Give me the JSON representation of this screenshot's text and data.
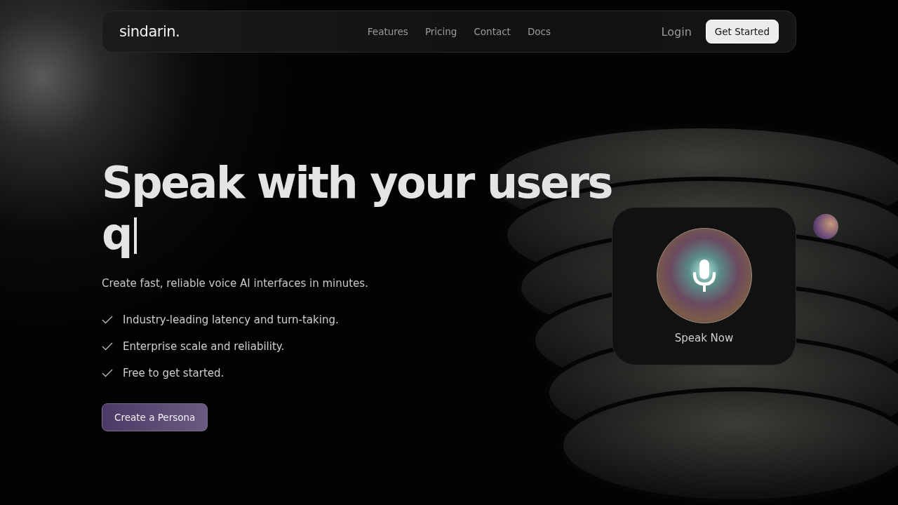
{
  "nav": {
    "logo": "sindarin.",
    "links": [
      "Features",
      "Pricing",
      "Contact",
      "Docs"
    ],
    "login": "Login",
    "cta": "Get Started"
  },
  "hero": {
    "headline": "Speak with your users",
    "typed": "q",
    "subtitle": "Create fast, reliable voice AI interfaces in minutes.",
    "features": [
      "Industry-leading latency and turn-taking.",
      "Enterprise scale and reliability.",
      "Free to get started."
    ],
    "button": "Create a Persona"
  },
  "voice_card": {
    "label": "Speak Now"
  }
}
